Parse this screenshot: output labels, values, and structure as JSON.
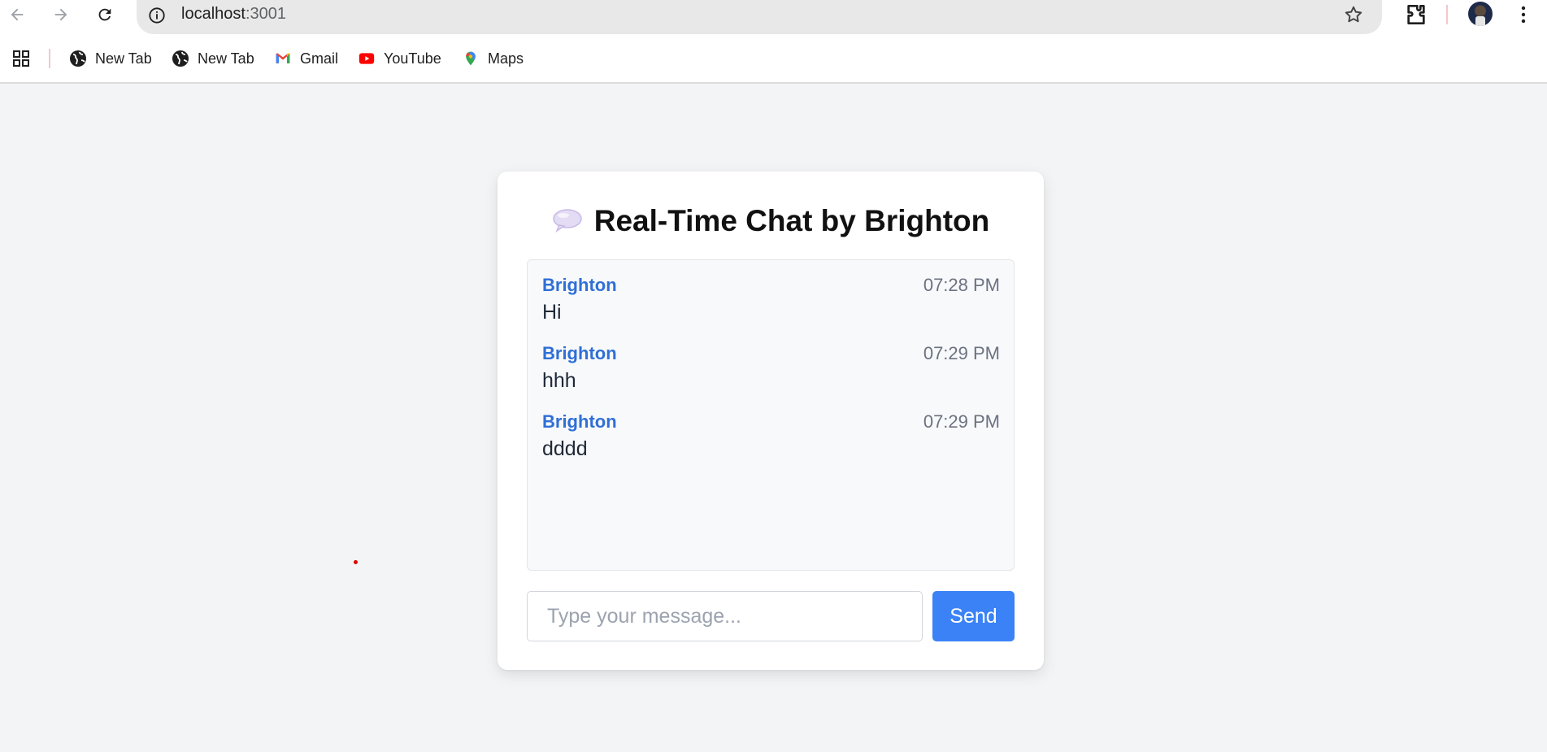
{
  "browser": {
    "url_host": "localhost",
    "url_port": ":3001",
    "bookmarks": [
      {
        "label": "New Tab",
        "icon": "globe-icon"
      },
      {
        "label": "New Tab",
        "icon": "globe-icon"
      },
      {
        "label": "Gmail",
        "icon": "gmail-icon"
      },
      {
        "label": "YouTube",
        "icon": "youtube-icon"
      },
      {
        "label": "Maps",
        "icon": "maps-icon"
      }
    ]
  },
  "chat": {
    "title_icon": "speech-bubble-icon",
    "title": "Real-Time Chat by Brighton",
    "messages": [
      {
        "user": "Brighton",
        "time": "07:28 PM",
        "text": "Hi"
      },
      {
        "user": "Brighton",
        "time": "07:29 PM",
        "text": "hhh"
      },
      {
        "user": "Brighton",
        "time": "07:29 PM",
        "text": "dddd"
      }
    ],
    "input_placeholder": "Type your message...",
    "input_value": "",
    "send_label": "Send"
  },
  "colors": {
    "accent": "#3b82f6",
    "username": "#2f6fd6",
    "page_bg": "#f3f4f6"
  }
}
